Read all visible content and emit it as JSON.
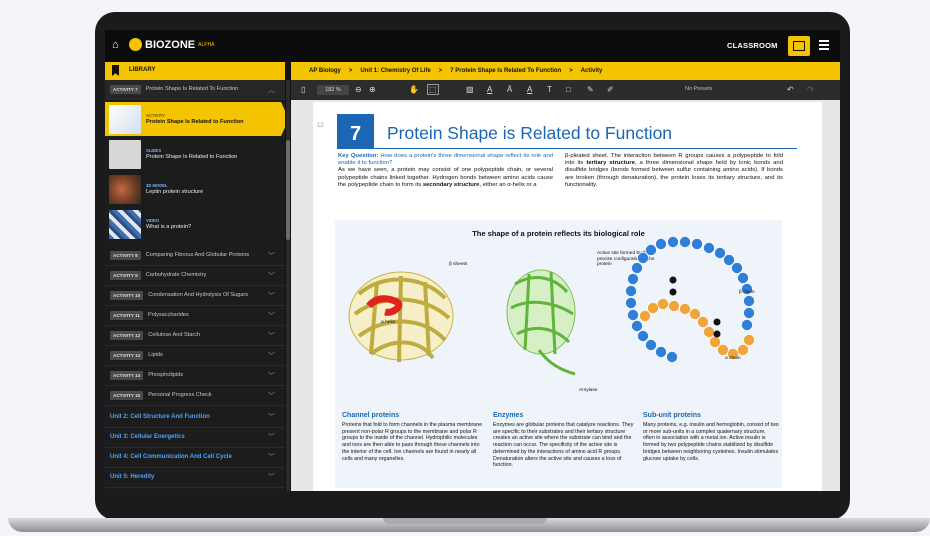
{
  "topbar": {
    "app_name": "BIOZONE",
    "app_tag": "ALPHA",
    "classroom_label": "CLASSROOM"
  },
  "library": {
    "label": "LIBRARY"
  },
  "breadcrumb": [
    "AP Biology",
    "Unit 1: Chemistry Of Life",
    "7 Protein Shape Is Related To Function",
    "Activity"
  ],
  "sidebar": {
    "open_activity": {
      "badge": "ACTIVITY 7",
      "title": "Protein Shape Is Related To Function"
    },
    "resources": [
      {
        "type": "ACTIVITY",
        "name": "Protein Shape Is Related to Function"
      },
      {
        "type": "SLIDES",
        "name": "Protein Shape Is Related to Function"
      },
      {
        "type": "3D MODEL",
        "name": "Leptin protein structure"
      },
      {
        "type": "VIDEO",
        "name": "What is a protein?"
      }
    ],
    "activities": [
      {
        "badge": "ACTIVITY 8",
        "title": "Comparing Fibrous And Globular Proteins"
      },
      {
        "badge": "ACTIVITY 9",
        "title": "Carbohydrate Chemistry"
      },
      {
        "badge": "ACTIVITY 10",
        "title": "Condensation And Hydrolysis Of Sugars"
      },
      {
        "badge": "ACTIVITY 11",
        "title": "Polysaccharides"
      },
      {
        "badge": "ACTIVITY 12",
        "title": "Cellulose And Starch"
      },
      {
        "badge": "ACTIVITY 13",
        "title": "Lipids"
      },
      {
        "badge": "ACTIVITY 14",
        "title": "Phospholipids"
      },
      {
        "badge": "ACTIVITY 15",
        "title": "Personal Progress Check"
      }
    ],
    "units": [
      "Unit 2: Cell Structure And Function",
      "Unit 3: Cellular Energetics",
      "Unit 4: Cell Communication And Cell Cycle",
      "Unit 5: Heredity"
    ]
  },
  "toolbar": {
    "zoom": "182 %",
    "presets": "No Presets"
  },
  "doc": {
    "page_number": "12",
    "activity_number": "7",
    "title": "Protein Shape is Related to Function",
    "key_question_label": "Key Question:",
    "key_question": "How does a protein's three dimensional shape reflect its role and enable it to function?",
    "left_text_1": "As we have seen, a protein may consist of one polypeptide chain, or several polypeptide chains linked together. Hydrogen bonds between amino acids cause the polypeptide chain to form its ",
    "left_bold": "secondary structure",
    "left_text_2": ", either an α-helix or a",
    "right_text_1": "β-pleated sheet. The interaction between R groups causes a polypeptide to fold into its ",
    "right_bold": "tertiary structure",
    "right_text_2": ", a three dimensional shape held by ionic bonds and disulfide bridges (bonds formed between sulfur containing amino acids). If bonds are broken (through denaturation), the protein loses its tertiary structure, and its functionality.",
    "figure_title": "The shape of a protein reflects its biological role",
    "labels": {
      "beta_sheets": "β sheets",
      "alpha_helix": "α helix",
      "active_site": "Active site formed by the precise configuration of the protein",
      "amylase": "Amylase",
      "beta_chain": "β chain",
      "alpha_chain": "α chain"
    },
    "sections": [
      {
        "heading": "Channel proteins",
        "text": "Proteins that fold to form channels in the plasma membrane present non-polar R groups to the membrane and polar R groups to the inside of the channel. Hydrophilic molecules and ions are then able to pass through these channels into the interior of the cell. Ion channels are found in nearly all cells and many organelles."
      },
      {
        "heading": "Enzymes",
        "text": "Enzymes are globular proteins that catalyze reactions. They are specific to their substrates and their tertiary structure creates an active site where the substrate can bind and the reaction can occur. The specificity of the active site is determined by the interactions of amino acid R groups. Denaturation alters the active site and causes a loss of function."
      },
      {
        "heading": "Sub-unit proteins",
        "text": "Many proteins, e.g. insulin and hemoglobin, consist of two or more sub-units in a complex quaternary structure, often in association with a metal ion. Active insulin is formed by two polypeptide chains stabilized by disulfide bridges between neighboring cysteines. Insulin stimulates glucose uptake by cells."
      }
    ]
  },
  "colors": {
    "accent": "#f5c400",
    "brand_blue": "#1b66b5",
    "link_blue": "#4ea2ff"
  }
}
